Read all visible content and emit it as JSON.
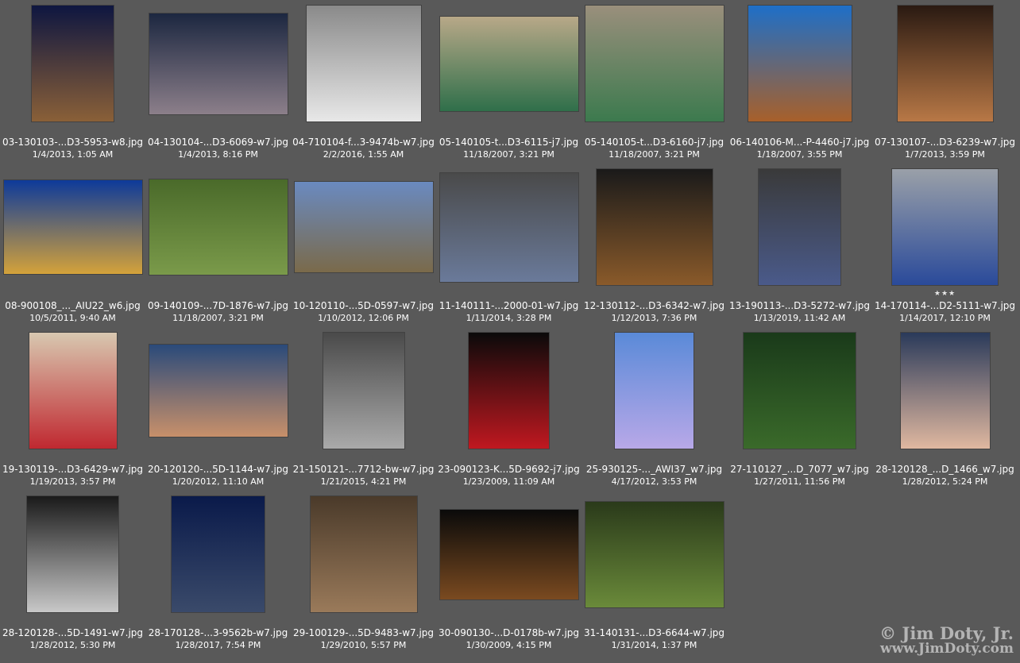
{
  "columns": 7,
  "items": [
    {
      "file": "03-130103-...D3-5953-w8.jpg",
      "date": "1/4/2013, 1:05 AM",
      "orient": "portrait",
      "w": 103,
      "h": 146,
      "top": "#0e1640",
      "bottom": "#8a6038",
      "rating": 0
    },
    {
      "file": "04-130104-...D3-6069-w7.jpg",
      "date": "1/4/2013, 8:16 PM",
      "orient": "landscape",
      "w": 174,
      "h": 127,
      "top": "#1c2740",
      "bottom": "#8c7f8a",
      "rating": 0
    },
    {
      "file": "04-710104-f...3-9474b-w7.jpg",
      "date": "2/2/2016, 1:55 AM",
      "orient": "landscape",
      "w": 144,
      "h": 146,
      "top": "#8a8a8a",
      "bottom": "#e8e8e8",
      "rating": 0
    },
    {
      "file": "05-140105-t...D3-6115-j7.jpg",
      "date": "11/18/2007, 3:21 PM",
      "orient": "landscape",
      "w": 174,
      "h": 119,
      "top": "#b8a888",
      "bottom": "#2f6f4a",
      "rating": 0
    },
    {
      "file": "05-140105-t...D3-6160-j7.jpg",
      "date": "11/18/2007, 3:21 PM",
      "orient": "landscape",
      "w": 174,
      "h": 146,
      "top": "#9a8f7c",
      "bottom": "#3c7a4e",
      "rating": 0
    },
    {
      "file": "06-140106-M...-P-4460-j7.jpg",
      "date": "1/18/2007, 3:55 PM",
      "orient": "portrait",
      "w": 130,
      "h": 146,
      "top": "#1e6fc8",
      "bottom": "#a8602a",
      "rating": 0
    },
    {
      "file": "07-130107-...D3-6239-w7.jpg",
      "date": "1/7/2013, 3:59 PM",
      "orient": "portrait",
      "w": 120,
      "h": 146,
      "top": "#2a1a12",
      "bottom": "#b87846",
      "rating": 0
    },
    {
      "file": "08-900108_..._AIU22_w6.jpg",
      "date": "10/5/2011, 9:40 AM",
      "orient": "landscape",
      "w": 174,
      "h": 118,
      "top": "#0d3a9a",
      "bottom": "#d4a23a",
      "rating": 0
    },
    {
      "file": "09-140109-...7D-1876-w7.jpg",
      "date": "11/18/2007, 3:21 PM",
      "orient": "landscape",
      "w": 174,
      "h": 120,
      "top": "#4a6a2a",
      "bottom": "#7a9a4a",
      "rating": 0
    },
    {
      "file": "10-120110-...5D-0597-w7.jpg",
      "date": "1/10/2012, 12:06 PM",
      "orient": "landscape",
      "w": 174,
      "h": 114,
      "top": "#6a8ac0",
      "bottom": "#7a6a4a",
      "rating": 0
    },
    {
      "file": "11-140111-...2000-01-w7.jpg",
      "date": "1/11/2014, 3:28 PM",
      "orient": "landscape",
      "w": 174,
      "h": 137,
      "top": "#4a4a4a",
      "bottom": "#6a7a9a",
      "rating": 0
    },
    {
      "file": "12-130112-...D3-6342-w7.jpg",
      "date": "1/12/2013, 7:36 PM",
      "orient": "portrait",
      "w": 146,
      "h": 146,
      "top": "#1a1a1a",
      "bottom": "#8a5a2a",
      "rating": 0
    },
    {
      "file": "13-190113-...D3-5272-w7.jpg",
      "date": "1/13/2019, 11:42 AM",
      "orient": "portrait",
      "w": 103,
      "h": 146,
      "top": "#3a3a3a",
      "bottom": "#4a5a8a",
      "rating": 0
    },
    {
      "file": "14-170114-...D2-5111-w7.jpg",
      "date": "1/14/2017, 12:10 PM",
      "orient": "portrait",
      "w": 133,
      "h": 146,
      "top": "#9aa0a8",
      "bottom": "#2a4a9a",
      "rating": 3
    },
    {
      "file": "19-130119-...D3-6429-w7.jpg",
      "date": "1/19/2013, 3:57 PM",
      "orient": "portrait",
      "w": 110,
      "h": 146,
      "top": "#d8c8b0",
      "bottom": "#c02830",
      "rating": 0
    },
    {
      "file": "20-120120-...5D-1144-w7.jpg",
      "date": "1/20/2012, 11:10 AM",
      "orient": "landscape",
      "w": 174,
      "h": 116,
      "top": "#2a4a7a",
      "bottom": "#c8906a",
      "rating": 0
    },
    {
      "file": "21-150121-...7712-bw-w7.jpg",
      "date": "1/21/2015, 4:21 PM",
      "orient": "portrait",
      "w": 102,
      "h": 146,
      "top": "#4a4a4a",
      "bottom": "#aaaaaa",
      "rating": 0
    },
    {
      "file": "23-090123-K...5D-9692-j7.jpg",
      "date": "1/23/2009, 11:09 AM",
      "orient": "portrait",
      "w": 101,
      "h": 146,
      "top": "#0a0a0a",
      "bottom": "#c01820",
      "rating": 0
    },
    {
      "file": "25-930125-..._AWI37_w7.jpg",
      "date": "4/17/2012, 3:53 PM",
      "orient": "portrait",
      "w": 99,
      "h": 146,
      "top": "#5a8ad8",
      "bottom": "#b8a8e8",
      "rating": 0
    },
    {
      "file": "27-110127_...D_7077_w7.jpg",
      "date": "1/27/2011, 11:56 PM",
      "orient": "portrait",
      "w": 141,
      "h": 146,
      "top": "#1a3a1a",
      "bottom": "#3a6a2a",
      "rating": 0
    },
    {
      "file": "28-120128_...D_1466_w7.jpg",
      "date": "1/28/2012, 5:24 PM",
      "orient": "portrait",
      "w": 112,
      "h": 146,
      "top": "#2a3a5a",
      "bottom": "#e0b8a0",
      "rating": 0
    },
    {
      "file": "28-120128-...5D-1491-w7.jpg",
      "date": "1/28/2012, 5:30 PM",
      "orient": "portrait",
      "w": 115,
      "h": 146,
      "top": "#1a1a1a",
      "bottom": "#c8c8c8",
      "rating": 0
    },
    {
      "file": "28-170128-...3-9562b-w7.jpg",
      "date": "1/28/2017, 7:54 PM",
      "orient": "portrait",
      "w": 117,
      "h": 146,
      "top": "#0a1a4a",
      "bottom": "#3a4a6a",
      "rating": 0
    },
    {
      "file": "29-100129-...5D-9483-w7.jpg",
      "date": "1/29/2010, 5:57 PM",
      "orient": "portrait",
      "w": 134,
      "h": 146,
      "top": "#4a3a2a",
      "bottom": "#9a7a5a",
      "rating": 0
    },
    {
      "file": "30-090130-...D-0178b-w7.jpg",
      "date": "1/30/2009, 4:15 PM",
      "orient": "landscape",
      "w": 174,
      "h": 113,
      "top": "#0a0a0a",
      "bottom": "#7a4a20",
      "rating": 0
    },
    {
      "file": "31-140131-...D3-6644-w7.jpg",
      "date": "1/31/2014, 1:37 PM",
      "orient": "landscape",
      "w": 174,
      "h": 133,
      "top": "#2a3a1a",
      "bottom": "#6a8a3a",
      "rating": 0
    }
  ],
  "watermark": {
    "line1": "© Jim Doty, Jr.",
    "line2": "www.JimDoty.com"
  }
}
